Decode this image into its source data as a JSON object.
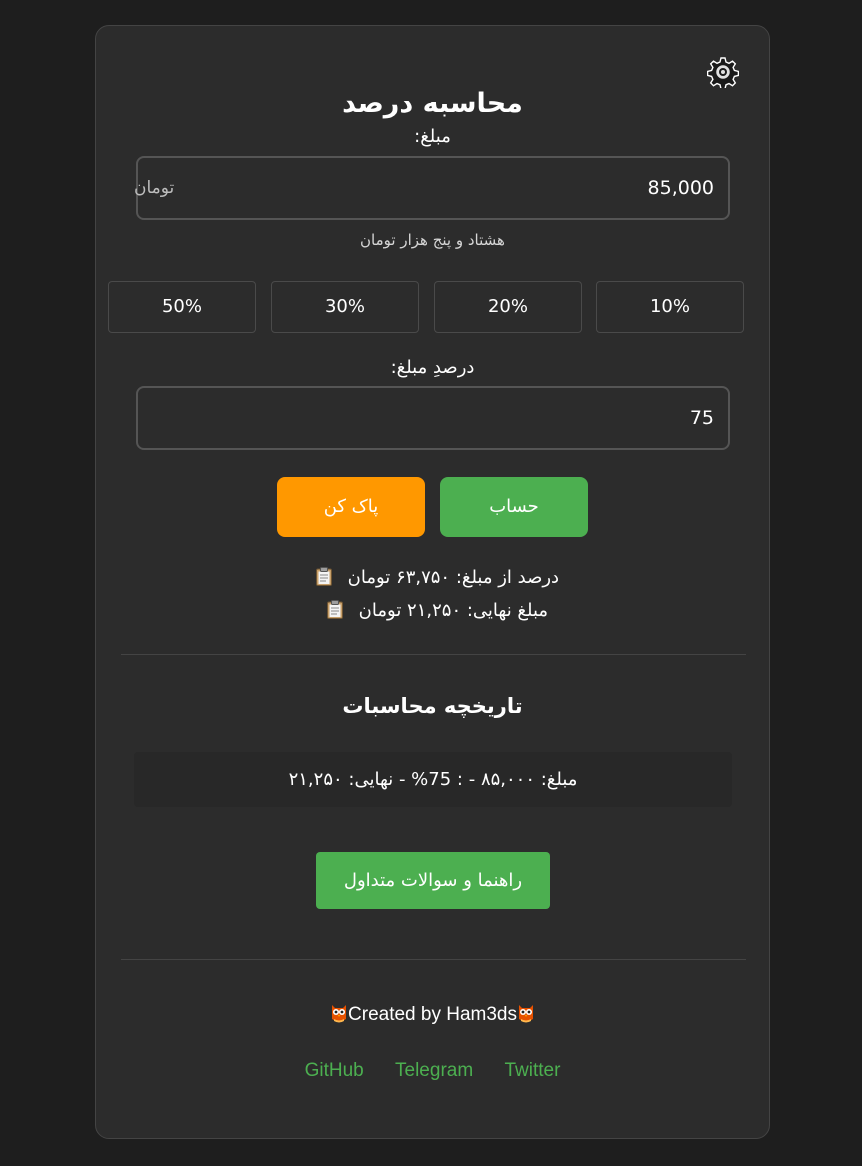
{
  "header": {
    "title": "محاسبه درصد",
    "settings_icon": "gear-icon"
  },
  "amount": {
    "label": "مبلغ:",
    "value": "85,000",
    "unit": "تومان",
    "in_words": "هشتاد و پنج هزار تومان"
  },
  "percent_buttons": [
    "50%",
    "30%",
    "20%",
    "10%"
  ],
  "percent_input": {
    "label": "درصدِ مبلغ:",
    "value": "75"
  },
  "actions": {
    "clear_label": "پاک کن",
    "calculate_label": "حساب",
    "clear_color": "#ff9800",
    "calculate_color": "#4caf50"
  },
  "results": {
    "percent_of_amount": "درصد از مبلغ: ۶۳,۷۵۰ تومان",
    "final_amount": "مبلغ نهایی: ۲۱,۲۵۰ تومان",
    "copy_icon": "clipboard-icon"
  },
  "history": {
    "title": "تاریخچه محاسبات",
    "items": [
      "مبلغ: ۸۵,۰۰۰ - : 75% - نهایی: ۲۱,۲۵۰"
    ]
  },
  "faq_button": "راهنما و سوالات متداول",
  "footer": {
    "credit": "Created by Ham3ds",
    "links": [
      "GitHub",
      "Telegram",
      "Twitter"
    ],
    "link_color": "#4caf50",
    "owl_icon": "owl-icon"
  }
}
